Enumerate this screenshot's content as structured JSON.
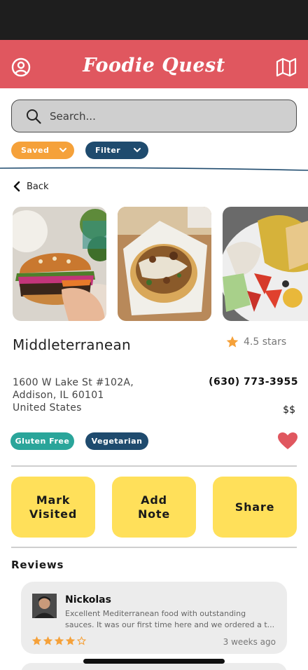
{
  "header": {
    "title": "Foodie Quest",
    "left_icon": "profile-icon",
    "right_icon": "map-icon",
    "color": "#e0575f"
  },
  "search": {
    "placeholder": "Search..."
  },
  "dropdowns": {
    "saved_label": "Saved",
    "filter_label": "Filter"
  },
  "nav": {
    "back_label": "Back"
  },
  "restaurant": {
    "name": "Middleterranean",
    "rating": "4.5 stars",
    "address_line1": "1600 W Lake St #102A,",
    "address_line2": "Addison, IL 60101",
    "address_line3": "United States",
    "phone": "(630) 773-3955",
    "price": "$$",
    "tags": [
      "Gluten Free",
      "Vegetarian"
    ],
    "favorited": true
  },
  "actions": {
    "mark_visited": "Mark\nVisited",
    "add_note": "Add\nNote",
    "share": "Share"
  },
  "reviews": {
    "title": "Reviews",
    "items": [
      {
        "author": "Nickolas",
        "text_line1": "Excellent Mediterranean food with outstanding",
        "text_line2": "sauces. It was our first time here and we ordered a t...",
        "stars": 4,
        "max_stars": 5,
        "time": "3 weeks ago"
      }
    ]
  },
  "colors": {
    "accent_orange": "#f5a13a",
    "navy": "#1f4b6e",
    "teal": "#2aa59a",
    "button_yellow": "#ffe05a",
    "heart_red": "#e0575f",
    "star_orange": "#f5a13a"
  }
}
